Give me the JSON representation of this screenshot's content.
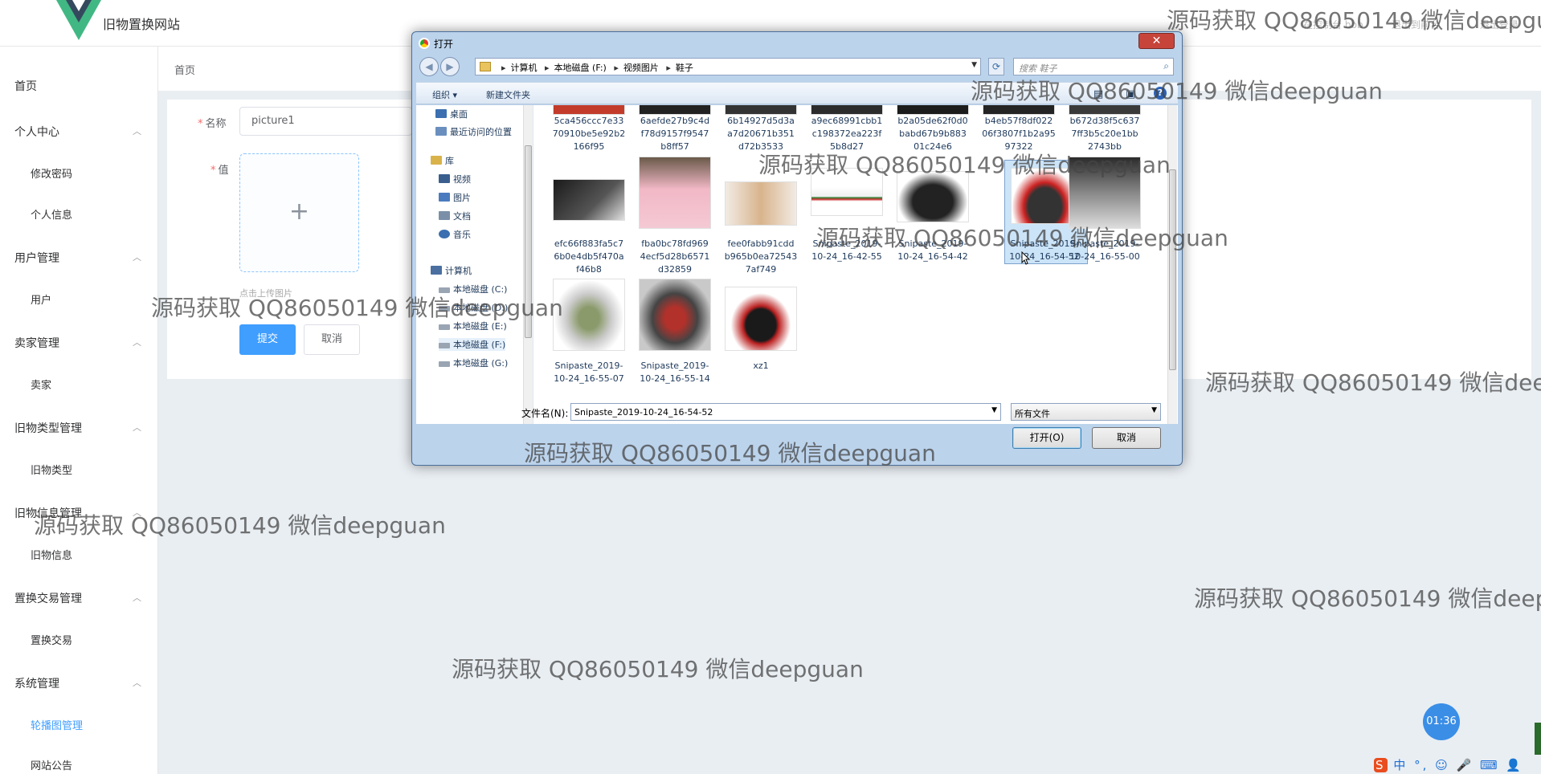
{
  "app": {
    "site_title": "旧物置换网站",
    "top_right": [
      "在控制台 bbb",
      "退出到前台",
      "退出登录"
    ],
    "breadcrumb": "首页"
  },
  "sidebar": {
    "items": [
      {
        "label": "首页"
      },
      {
        "label": "个人中心"
      },
      {
        "label": "修改密码"
      },
      {
        "label": "个人信息"
      },
      {
        "label": "用户管理"
      },
      {
        "label": "用户"
      },
      {
        "label": "卖家管理"
      },
      {
        "label": "卖家"
      },
      {
        "label": "旧物类型管理"
      },
      {
        "label": "旧物类型"
      },
      {
        "label": "旧物信息管理"
      },
      {
        "label": "旧物信息"
      },
      {
        "label": "置换交易管理"
      },
      {
        "label": "置换交易"
      },
      {
        "label": "系统管理"
      },
      {
        "label": "轮播图管理"
      },
      {
        "label": "网站公告"
      }
    ],
    "active": "轮播图管理"
  },
  "form": {
    "name_label": "名称",
    "name_value": "picture1",
    "value_label": "值",
    "upload_plus": "+",
    "upload_hint": "点击上传图片",
    "submit": "提交",
    "cancel": "取消"
  },
  "dialog": {
    "title": "打开",
    "close": "✕",
    "path": [
      "计算机",
      "本地磁盘 (F:)",
      "视频图片",
      "鞋子"
    ],
    "search_placeholder": "搜索 鞋子",
    "toolbar": {
      "organize": "组织 ▾",
      "new_folder": "新建文件夹"
    },
    "tree": [
      {
        "label": "桌面",
        "color": "#3b6fb0"
      },
      {
        "label": "最近访问的位置",
        "color": "#6a8fbf"
      },
      {
        "label": "库",
        "color": "#d9b24a"
      },
      {
        "label": "视频",
        "color": "#3a5f8f"
      },
      {
        "label": "图片",
        "color": "#4b7bbf"
      },
      {
        "label": "文档",
        "color": "#7b8fa8"
      },
      {
        "label": "音乐",
        "color": "#3b6fb0"
      },
      {
        "label": "计算机",
        "color": "#4a6fa0"
      },
      {
        "label": "本地磁盘 (C:)",
        "color": "#9aa5b3"
      },
      {
        "label": "本地磁盘 (D:)",
        "color": "#9aa5b3"
      },
      {
        "label": "本地磁盘 (E:)",
        "color": "#9aa5b3"
      },
      {
        "label": "本地磁盘 (F:)",
        "color": "#9aa5b3"
      },
      {
        "label": "本地磁盘 (G:)",
        "color": "#9aa5b3"
      }
    ],
    "files_row0": [
      "5ca456ccc7e33\n70910be5e92b2\n166f95",
      "6aefde27b9c4d\nf78d9157f9547\nb8ff57",
      "6b14927d5d3a\na7d20671b351\nd72b3533",
      "a9ec68991cbb1\nc198372ea223f\n5b8d27",
      "b2a05de62f0d0\nbabd67b9b883\n01c24e6",
      "b4eb57f8df022\n06f3807f1b2a95\n97322",
      "b672d38f5c637\n7ff3b5c20e1bb\n2743bb"
    ],
    "files_row1": [
      "efc66f883fa5c7\n6b0e4db5f470a\nf46b8",
      "fba0bc78fd969\n4ecf5d28b6571\nd32859",
      "fee0fabb91cdd\nb965b0ea72543\n7af749",
      "Snipaste_2019-\n10-24_16-42-55",
      "Snipaste_2019-\n10-24_16-54-42",
      "Snipaste_2019-\n10-24_16-54-52",
      "Snipaste_2019-\n10-24_16-55-00"
    ],
    "files_row2": [
      "Snipaste_2019-\n10-24_16-55-07",
      "Snipaste_2019-\n10-24_16-55-14",
      "xz1"
    ],
    "selected": "Snipaste_2019-10-24_16-54-52",
    "filename_label": "文件名(N):",
    "filename_value": "Snipaste_2019-10-24_16-54-52",
    "filetype": "所有文件",
    "open": "打开(O)",
    "cancel": "取消"
  },
  "watermark": "源码获取 QQ86050149 微信deepguan",
  "timer": "01:36",
  "tray": {
    "ime": "S",
    "text": "中 °, ☺ 🎤 ⌨ 👤 👕 ⊞"
  }
}
